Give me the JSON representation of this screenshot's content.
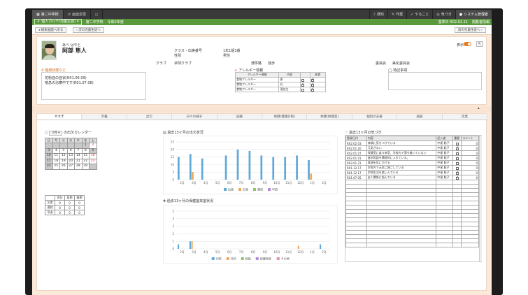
{
  "topbar": {
    "tabs": [
      {
        "label": "第二中学校",
        "icon": "building-icon"
      },
      {
        "label": "画面変更",
        "icon": "switch-icon"
      }
    ],
    "right": [
      {
        "label": "通知",
        "icon": "bell-icon"
      },
      {
        "label": "作業",
        "icon": "tool-icon"
      },
      {
        "label": "やること",
        "icon": "check-icon"
      },
      {
        "label": "気づき",
        "icon": "bulb-icon"
      },
      {
        "label": "システム管理者",
        "icon": "user-icon"
      }
    ]
  },
  "greenbar": {
    "screen_select": "個人カルテ(児童生徒)",
    "school": "第二中学校",
    "year": "令和2年度",
    "right": [
      "基準日 R02.02.21",
      "閲覧者情報"
    ]
  },
  "actionbar": {
    "back": "検索画面へ戻る",
    "next": "次の児童生徒へ",
    "prev": "前の児童生徒へ"
  },
  "profile": {
    "kana": "あべ はやと",
    "name": "阿部 隼人",
    "class_label": "クラス・出席番号",
    "class_value": "1年1組1番",
    "gender_label": "性別",
    "gender_value": "男性",
    "club_label": "クラブ",
    "club_value": "卓球クラブ",
    "committee_label": "委員会",
    "committee_value": "美化委員会",
    "commute_label": "通学路",
    "commute_value": "徒歩",
    "notice_label": "健康状況",
    "toggle_label": "表示",
    "health_title": "健康状態など",
    "health_items": [
      "花粉症の症状(R01.06.09)",
      "喘息の治療中です(R01.07.08)"
    ],
    "allergy_title": "アレルギー情報",
    "allergy_headers": [
      "アレルギー情報",
      "内容",
      "",
      "給食"
    ],
    "allergy_rows": [
      {
        "type": "食物アレルギー",
        "content": "卵",
        "a": false,
        "b": true
      },
      {
        "type": "食物アレルギー",
        "content": "乳",
        "a": true,
        "b": true
      },
      {
        "type": "食物アレルギー",
        "content": "落花生",
        "a": false,
        "b": true
      }
    ],
    "special_title": "特記事項"
  },
  "tabs": [
    "学籍",
    "出欠",
    "日々の様子",
    "成績",
    "保健(健康診断)",
    "保健(保健室)",
    "個別の支援",
    "調査",
    "卒業"
  ],
  "calendar": {
    "title": "の出欠カレンダー",
    "month": "2月",
    "weekdays": [
      "日",
      "月",
      "火",
      "水",
      "木",
      "金",
      "土"
    ],
    "weeks": [
      [
        {
          "d": "",
          "g": true
        },
        {
          "d": "",
          "g": true
        },
        {
          "d": "",
          "g": true
        },
        {
          "d": "",
          "g": true
        },
        {
          "d": "",
          "g": true
        },
        {
          "d": "1",
          "g": true
        },
        {
          "d": "2",
          "r": true
        }
      ],
      [
        {
          "d": "3",
          "g": true
        },
        {
          "d": "4"
        },
        {
          "d": "5"
        },
        {
          "d": "6"
        },
        {
          "d": "7"
        },
        {
          "d": "8"
        },
        {
          "d": "9",
          "g": true
        }
      ],
      [
        {
          "d": "10",
          "g": true
        },
        {
          "d": "11"
        },
        {
          "d": "12"
        },
        {
          "d": "13"
        },
        {
          "d": "14"
        },
        {
          "d": "15"
        },
        {
          "d": "16",
          "r": true
        }
      ],
      [
        {
          "d": "17",
          "g": true
        },
        {
          "d": "18"
        },
        {
          "d": "19"
        },
        {
          "d": "20"
        },
        {
          "d": "21"
        },
        {
          "d": "22"
        },
        {
          "d": "23",
          "r": true
        }
      ],
      [
        {
          "d": "24",
          "g": true
        },
        {
          "d": "25"
        },
        {
          "d": "26"
        },
        {
          "d": "27"
        },
        {
          "d": "28"
        },
        {
          "d": "29"
        },
        {
          "d": "",
          "g": true
        }
      ]
    ],
    "totals_headers": [
      "",
      "合計",
      "前期",
      "後期"
    ],
    "totals_rows": [
      {
        "label": "欠席",
        "v": [
          "0",
          "0",
          "0"
        ]
      },
      {
        "label": "遅刻",
        "v": [
          "0",
          "0",
          "0"
        ]
      },
      {
        "label": "早退",
        "v": [
          "0",
          "0",
          "0"
        ]
      }
    ]
  },
  "chart_top": {
    "title": "過去13ヶ月の出欠状況"
  },
  "chart_bottom": {
    "title": "過去13ヶ月の保健室来室状況"
  },
  "chart_data": [
    {
      "type": "bar",
      "title": "過去13ヶ月の出欠状況",
      "categories": [
        "2月",
        "3月",
        "4月",
        "5月",
        "6月",
        "7月",
        "8月",
        "9月",
        "10月",
        "11月",
        "12月",
        "1月",
        "2月"
      ],
      "ylim": [
        0,
        25
      ],
      "yticks": [
        0,
        5,
        10,
        15,
        20,
        25
      ],
      "series": [
        {
          "name": "出席",
          "color": "#5fa9d9",
          "values": [
            15,
            17,
            14,
            0,
            16,
            20,
            19,
            16,
            15,
            15,
            16,
            13,
            0
          ]
        },
        {
          "name": "欠席",
          "color": "#f0a85a",
          "values": [
            0,
            5,
            0,
            0,
            0,
            0,
            0,
            0,
            0,
            0,
            0,
            4,
            0
          ]
        },
        {
          "name": "遅刻",
          "color": "#8cc56e",
          "values": [
            0,
            0,
            0,
            0,
            0,
            0,
            0,
            0,
            0,
            0,
            0,
            0,
            0
          ]
        },
        {
          "name": "早退",
          "color": "#b48ad8",
          "values": [
            0,
            0,
            0,
            0,
            0,
            0,
            0,
            0,
            0,
            0,
            0,
            0,
            0
          ]
        }
      ]
    },
    {
      "type": "bar",
      "title": "過去13ヶ月の保健室来室状況",
      "categories": [
        "2月",
        "3月",
        "4月",
        "5月",
        "6月",
        "7月",
        "8月",
        "9月",
        "10月",
        "11月",
        "12月",
        "1月",
        "2月"
      ],
      "ylim": [
        0,
        5
      ],
      "yticks": [
        0,
        1,
        2,
        3,
        4,
        5
      ],
      "series": [
        {
          "name": "内科",
          "color": "#5fa9d9",
          "values": [
            0.6,
            1,
            0,
            0,
            0,
            0,
            0,
            0,
            0,
            0,
            0,
            0,
            0.6
          ]
        },
        {
          "name": "外科",
          "color": "#f0a85a",
          "values": [
            0,
            1,
            0,
            0,
            0,
            0,
            0,
            0,
            0,
            0,
            0.4,
            0,
            0
          ]
        },
        {
          "name": "相談",
          "color": "#8cc56e",
          "values": [
            0,
            0,
            0,
            0,
            0,
            0,
            0,
            0,
            0,
            0,
            0,
            0,
            0
          ]
        },
        {
          "name": "保健指導",
          "color": "#b48ad8",
          "values": [
            0,
            0,
            0,
            0,
            0,
            0,
            0,
            0,
            0,
            0,
            0,
            0,
            0
          ]
        },
        {
          "name": "その他",
          "color": "#e58fb0",
          "values": [
            0,
            0,
            0,
            0,
            0,
            0,
            0,
            0,
            0,
            0,
            0,
            0,
            0
          ]
        }
      ]
    }
  ],
  "notes": {
    "title": "過去13ヶ月の気づき",
    "headers": [
      "登録日付",
      "内容",
      "記入者",
      "重要",
      "コメント"
    ],
    "rows": [
      {
        "date": "R02.02.03",
        "content": "体調に気をつけている",
        "author": "中尾 聡子",
        "imp": false,
        "c": "0"
      },
      {
        "date": "R02.01.20",
        "content": "元気がない",
        "author": "中尾 聡子",
        "imp": true,
        "c": "0"
      },
      {
        "date": "R02.01.07",
        "content": "保健室に度々来室、学校内で落ち着いていない",
        "author": "中尾 聡子",
        "imp": false,
        "c": "0"
      },
      {
        "date": "R02.01.01",
        "content": "進学相談を積極的に入れている。",
        "author": "中尾 聡子",
        "imp": false,
        "c": "0"
      },
      {
        "date": "R02.01.21",
        "content": "体調を気にかける",
        "author": "中尾 聡子",
        "imp": false,
        "c": "0"
      },
      {
        "date": "R01.12.17",
        "content": "学校内で元気に過ごしている",
        "author": "中尾 聡子",
        "imp": false,
        "c": "0"
      },
      {
        "date": "R01.12.17",
        "content": "学校生活を楽しんでいる",
        "author": "中尾 聡子",
        "imp": true,
        "c": "0"
      },
      {
        "date": "R01.07.05",
        "content": "友人関係に悩んでいる",
        "author": "中尾 聡子",
        "imp": true,
        "c": "0"
      }
    ]
  }
}
